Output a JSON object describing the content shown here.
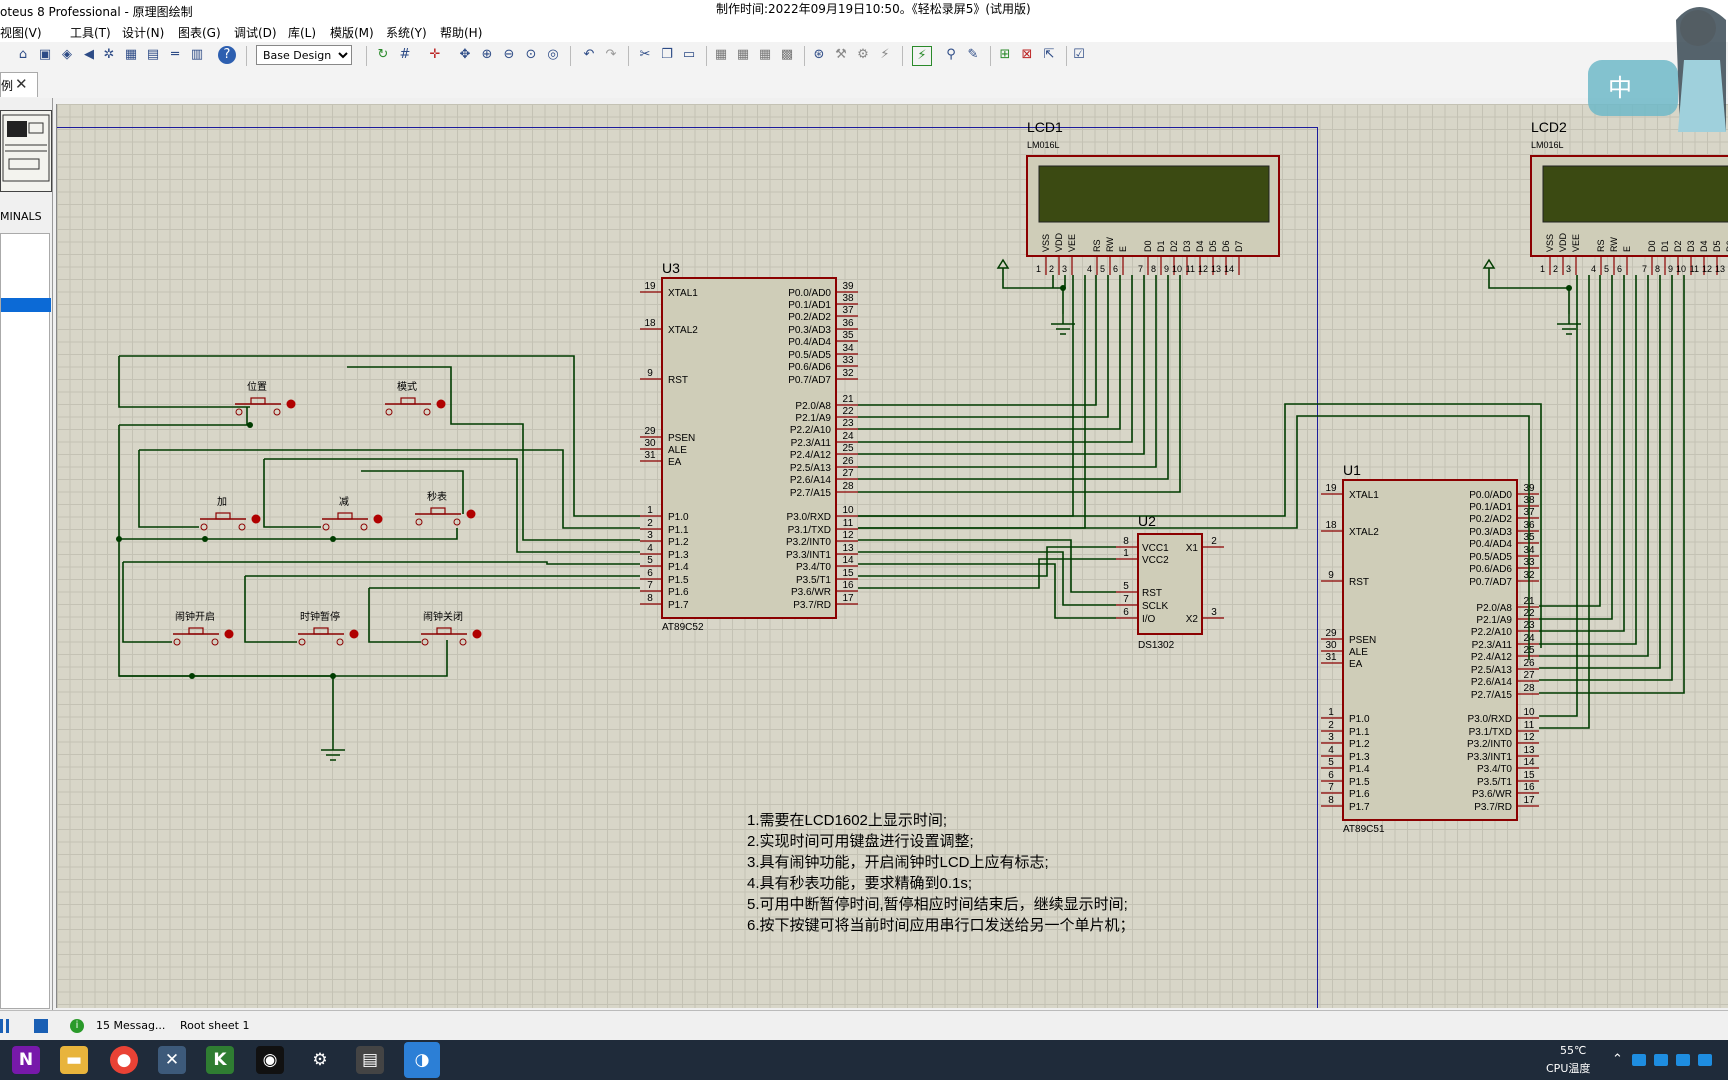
{
  "window": {
    "app_title": "oteus 8 Professional - 原理图绘制",
    "recording_title": "制作时间:2022年09月19日10:50。《轻松录屏5》(试用版)"
  },
  "menu": [
    "视图(V)",
    "工具(T)",
    "设计(N)",
    "图表(G)",
    "调试(D)",
    "库(L)",
    "模版(M)",
    "系统(Y)",
    "帮助(H)"
  ],
  "toolbar": {
    "design_select": "Base Design",
    "icons": [
      "home-icon",
      "chip-icon",
      "component-icon",
      "back-icon",
      "probe-icon",
      "pcb-icon",
      "bom-icon",
      "netlist-icon",
      "report-icon",
      "help-icon",
      "refresh-icon",
      "grid-icon",
      "origin-icon",
      "pan-icon",
      "zoom-in-icon",
      "zoom-out-icon",
      "zoom-all-icon",
      "zoom-area-icon",
      "undo-icon",
      "redo-icon",
      "cut-icon",
      "copy-icon",
      "paste-icon",
      "block-copy-icon",
      "block-move-icon",
      "block-rotate-icon",
      "block-delete-icon",
      "pick-icon",
      "make-device-icon",
      "packaging-icon",
      "decompose-icon",
      "wire-autoroute-icon",
      "search-icon",
      "property-icon",
      "new-sheet-icon",
      "remove-sheet-icon",
      "exit-sheet-icon",
      "erc-icon"
    ]
  },
  "tab": {
    "label": "例",
    "close": "✕"
  },
  "left_panel": {
    "terminals_label": "MINALS"
  },
  "schematic": {
    "u3": {
      "ref": "U3",
      "part": "AT89C52",
      "left_pins": [
        {
          "num": "19",
          "name": "XTAL1"
        },
        {
          "num": "18",
          "name": "XTAL2"
        },
        {
          "num": "9",
          "name": "RST"
        },
        {
          "num": "29",
          "name": "PSEN"
        },
        {
          "num": "30",
          "name": "ALE"
        },
        {
          "num": "31",
          "name": "EA"
        },
        {
          "num": "1",
          "name": "P1.0"
        },
        {
          "num": "2",
          "name": "P1.1"
        },
        {
          "num": "3",
          "name": "P1.2"
        },
        {
          "num": "4",
          "name": "P1.3"
        },
        {
          "num": "5",
          "name": "P1.4"
        },
        {
          "num": "6",
          "name": "P1.5"
        },
        {
          "num": "7",
          "name": "P1.6"
        },
        {
          "num": "8",
          "name": "P1.7"
        }
      ],
      "right_pins": [
        {
          "num": "39",
          "name": "P0.0/AD0"
        },
        {
          "num": "38",
          "name": "P0.1/AD1"
        },
        {
          "num": "37",
          "name": "P0.2/AD2"
        },
        {
          "num": "36",
          "name": "P0.3/AD3"
        },
        {
          "num": "35",
          "name": "P0.4/AD4"
        },
        {
          "num": "34",
          "name": "P0.5/AD5"
        },
        {
          "num": "33",
          "name": "P0.6/AD6"
        },
        {
          "num": "32",
          "name": "P0.7/AD7"
        },
        {
          "num": "21",
          "name": "P2.0/A8"
        },
        {
          "num": "22",
          "name": "P2.1/A9"
        },
        {
          "num": "23",
          "name": "P2.2/A10"
        },
        {
          "num": "24",
          "name": "P2.3/A11"
        },
        {
          "num": "25",
          "name": "P2.4/A12"
        },
        {
          "num": "26",
          "name": "P2.5/A13"
        },
        {
          "num": "27",
          "name": "P2.6/A14"
        },
        {
          "num": "28",
          "name": "P2.7/A15"
        },
        {
          "num": "10",
          "name": "P3.0/RXD"
        },
        {
          "num": "11",
          "name": "P3.1/TXD"
        },
        {
          "num": "12",
          "name": "P3.2/INT0"
        },
        {
          "num": "13",
          "name": "P3.3/INT1"
        },
        {
          "num": "14",
          "name": "P3.4/T0"
        },
        {
          "num": "15",
          "name": "P3.5/T1"
        },
        {
          "num": "16",
          "name": "P3.6/WR"
        },
        {
          "num": "17",
          "name": "P3.7/RD"
        }
      ]
    },
    "u1": {
      "ref": "U1",
      "part": "AT89C51",
      "left_pins": [
        {
          "num": "19",
          "name": "XTAL1"
        },
        {
          "num": "18",
          "name": "XTAL2"
        },
        {
          "num": "9",
          "name": "RST"
        },
        {
          "num": "29",
          "name": "PSEN"
        },
        {
          "num": "30",
          "name": "ALE"
        },
        {
          "num": "31",
          "name": "EA"
        },
        {
          "num": "1",
          "name": "P1.0"
        },
        {
          "num": "2",
          "name": "P1.1"
        },
        {
          "num": "3",
          "name": "P1.2"
        },
        {
          "num": "4",
          "name": "P1.3"
        },
        {
          "num": "5",
          "name": "P1.4"
        },
        {
          "num": "6",
          "name": "P1.5"
        },
        {
          "num": "7",
          "name": "P1.6"
        },
        {
          "num": "8",
          "name": "P1.7"
        }
      ],
      "right_pins": [
        {
          "num": "39",
          "name": "P0.0/AD0"
        },
        {
          "num": "38",
          "name": "P0.1/AD1"
        },
        {
          "num": "37",
          "name": "P0.2/AD2"
        },
        {
          "num": "36",
          "name": "P0.3/AD3"
        },
        {
          "num": "35",
          "name": "P0.4/AD4"
        },
        {
          "num": "34",
          "name": "P0.5/AD5"
        },
        {
          "num": "33",
          "name": "P0.6/AD6"
        },
        {
          "num": "32",
          "name": "P0.7/AD7"
        },
        {
          "num": "21",
          "name": "P2.0/A8"
        },
        {
          "num": "22",
          "name": "P2.1/A9"
        },
        {
          "num": "23",
          "name": "P2.2/A10"
        },
        {
          "num": "24",
          "name": "P2.3/A11"
        },
        {
          "num": "25",
          "name": "P2.4/A12"
        },
        {
          "num": "26",
          "name": "P2.5/A13"
        },
        {
          "num": "27",
          "name": "P2.6/A14"
        },
        {
          "num": "28",
          "name": "P2.7/A15"
        },
        {
          "num": "10",
          "name": "P3.0/RXD"
        },
        {
          "num": "11",
          "name": "P3.1/TXD"
        },
        {
          "num": "12",
          "name": "P3.2/INT0"
        },
        {
          "num": "13",
          "name": "P3.3/INT1"
        },
        {
          "num": "14",
          "name": "P3.4/T0"
        },
        {
          "num": "15",
          "name": "P3.5/T1"
        },
        {
          "num": "16",
          "name": "P3.6/WR"
        },
        {
          "num": "17",
          "name": "P3.7/RD"
        }
      ]
    },
    "u2": {
      "ref": "U2",
      "part": "DS1302",
      "left_pins": [
        {
          "num": "8",
          "name": "VCC1"
        },
        {
          "num": "1",
          "name": "VCC2"
        },
        {
          "num": "5",
          "name": "RST"
        },
        {
          "num": "7",
          "name": "SCLK"
        },
        {
          "num": "6",
          "name": "I/O"
        }
      ],
      "right_pins": [
        {
          "num": "2",
          "name": "X1"
        },
        {
          "num": "3",
          "name": "X2"
        }
      ]
    },
    "lcd1": {
      "ref": "LCD1",
      "part": "LM016L"
    },
    "lcd2": {
      "ref": "LCD2",
      "part": "LM016L"
    },
    "lcd_pin_names": [
      "VSS",
      "VDD",
      "VEE",
      "RS",
      "RW",
      "E",
      "D0",
      "D1",
      "D2",
      "D3",
      "D4",
      "D5",
      "D6",
      "D7"
    ],
    "lcd_pin_nums": [
      "1",
      "2",
      "3",
      "4",
      "5",
      "6",
      "7",
      "8",
      "9",
      "10",
      "11",
      "12",
      "13",
      "14"
    ],
    "buttons": [
      "位置",
      "模式",
      "加",
      "减",
      "秒表",
      "闹钟开启",
      "时钟暂停",
      "闹钟关闭"
    ],
    "notes": [
      "1.需要在LCD1602上显示时间;",
      "2.实现时间可用键盘进行设置调整;",
      "3.具有闹钟功能，开启闹钟时LCD上应有标志;",
      "4.具有秒表功能，要求精确到0.1s;",
      "5.可用中断暂停时间,暂停相应时间结束后，继续显示时间;",
      "6.按下按键可将当前时间应用串行口发送给另一个单片机；"
    ]
  },
  "status": {
    "messages": "15 Messag...",
    "sheet": "Root sheet 1"
  },
  "tray": {
    "temp": "55℃",
    "cpu_label": "CPU温度"
  },
  "taskbar": [
    "onenote-icon",
    "file-explorer-icon",
    "chrome-icon",
    "proteus-icon",
    "keil-icon",
    "qq-icon",
    "settings-icon",
    "editor-icon",
    "recorder-icon"
  ]
}
